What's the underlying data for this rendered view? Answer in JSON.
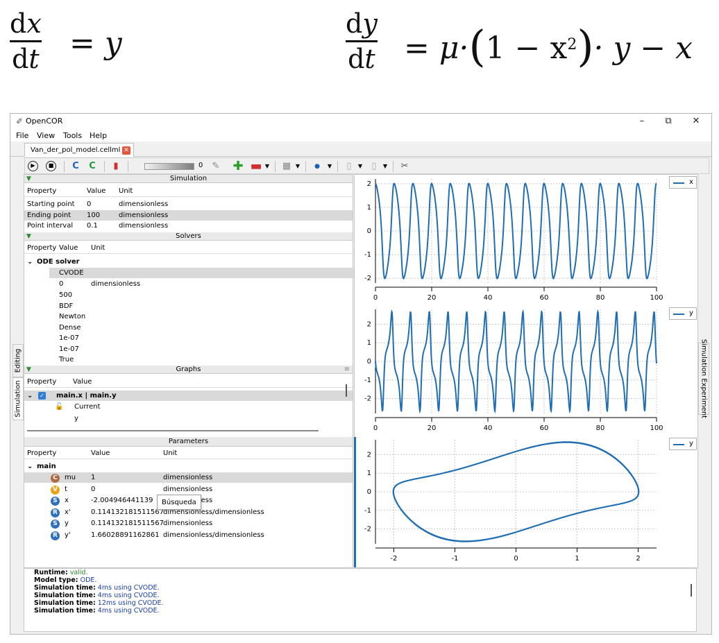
{
  "equations": {
    "dx": {
      "num_d": "d",
      "num_v": "x",
      "den_d": "d",
      "den_v": "t",
      "rhs": "y"
    },
    "dy": {
      "num_d": "d",
      "num_v": "y",
      "den_d": "d",
      "den_v": "t",
      "rhs_pre": "μ·",
      "rhs_one": "1 − x",
      "rhs_exp": "2",
      "rhs_post": "· y − x"
    }
  },
  "window": {
    "title": "OpenCOR",
    "minimize": "–",
    "restore": "⧉",
    "close": "✕"
  },
  "menu": [
    "File",
    "View",
    "Tools",
    "Help"
  ],
  "tab": {
    "label": "Van_der_pol_model.cellml",
    "close": "✕"
  },
  "toolbar": {
    "slider_value": "0"
  },
  "side_tabs": {
    "editing": "Editing",
    "simulation": "Simulation",
    "experiment": "Simulation Experiment"
  },
  "simulation": {
    "header": "Simulation",
    "columns": [
      "Property",
      "Value",
      "Unit"
    ],
    "rows": [
      {
        "property": "Starting point",
        "value": "0",
        "unit": "dimensionless"
      },
      {
        "property": "Ending point",
        "value": "100",
        "unit": "dimensionless"
      },
      {
        "property": "Point interval",
        "value": "0.1",
        "unit": "dimensionless"
      }
    ]
  },
  "solvers": {
    "header": "Solvers",
    "columns": [
      "Property",
      "Value",
      "Unit"
    ],
    "group": "ODE solver",
    "values": [
      "CVODE",
      "0",
      "500",
      "BDF",
      "Newton",
      "Dense",
      "1e-07",
      "1e-07",
      "True"
    ],
    "unit0": "dimensionless"
  },
  "graphs": {
    "header": "Graphs",
    "columns": [
      "Property",
      "Value"
    ],
    "item": "main.x | main.y",
    "current": "Current",
    "y": "y"
  },
  "parameters": {
    "header": "Parameters",
    "columns": [
      "Property",
      "Value",
      "Unit"
    ],
    "group": "main",
    "rows": [
      {
        "badge": "C",
        "name": "mu",
        "value": "1",
        "unit": "dimensionless"
      },
      {
        "badge": "V",
        "name": "t",
        "value": "0",
        "unit": "dimensionless"
      },
      {
        "badge": "S",
        "name": "x",
        "value": "-2.004946441139",
        "unit": "dimensionless"
      },
      {
        "badge": "R",
        "name": "x'",
        "value": "0.114132181511567",
        "unit": "dimensionless/dimensionless"
      },
      {
        "badge": "S",
        "name": "y",
        "value": "0.114132181511567",
        "unit": "dimensionless"
      },
      {
        "badge": "R",
        "name": "y'",
        "value": "1.66028891162861",
        "unit": "dimensionless/dimensionless"
      }
    ]
  },
  "output": [
    {
      "label": "Runtime:",
      "value": "valid."
    },
    {
      "label": "Model type:",
      "value": "ODE."
    },
    {
      "label": "Simulation time:",
      "value": "4ms using CVODE."
    },
    {
      "label": "Simulation time:",
      "value": "4ms using CVODE."
    },
    {
      "label": "Simulation time:",
      "value": "12ms using CVODE."
    },
    {
      "label": "Simulation time:",
      "value": "4ms using CVODE."
    }
  ],
  "tooltip": "Búsqueda",
  "chart_data": [
    {
      "type": "line",
      "legend": [
        "x"
      ],
      "xlim": [
        0,
        100
      ],
      "ylim": [
        -2.2,
        2.2
      ],
      "xticks": [
        "0",
        "20",
        "40",
        "60",
        "80",
        "100"
      ],
      "yticks": [
        "2",
        "1",
        "0",
        "-1",
        "-2"
      ],
      "series": [
        {
          "name": "x",
          "x": "t 0..100",
          "function": "van der Pol x(t), mu=1",
          "color": "#1f6db3"
        }
      ]
    },
    {
      "type": "line",
      "legend": [
        "y"
      ],
      "xlim": [
        0,
        100
      ],
      "ylim": [
        -2.8,
        2.8
      ],
      "xticks": [
        "0",
        "20",
        "40",
        "60",
        "80",
        "100"
      ],
      "yticks": [
        "2",
        "1",
        "0",
        "-1",
        "-2"
      ],
      "series": [
        {
          "name": "y",
          "x": "t 0..100",
          "function": "van der Pol y(t), mu=1",
          "color": "#1f6db3"
        }
      ]
    },
    {
      "type": "line",
      "legend": [
        "y"
      ],
      "xlim": [
        -2.3,
        2.3
      ],
      "ylim": [
        -2.8,
        2.8
      ],
      "xticks": [
        "-2",
        "-1",
        "0",
        "1",
        "2"
      ],
      "yticks": [
        "2",
        "1",
        "0",
        "-1",
        "-2"
      ],
      "series": [
        {
          "name": "y",
          "x": "x",
          "function": "van der Pol limit cycle (x vs y), mu=1",
          "color": "#1f6db3"
        }
      ]
    }
  ]
}
